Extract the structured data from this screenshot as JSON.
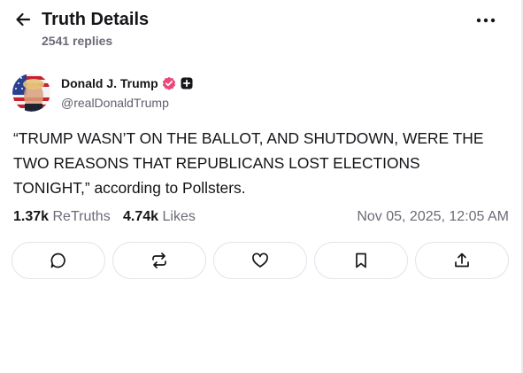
{
  "header": {
    "title": "Truth Details",
    "replies": "2541 replies",
    "back_icon": "arrow-left-icon",
    "more_icon": "ellipsis-icon"
  },
  "author": {
    "name": "Donald J. Trump",
    "handle": "@realDonaldTrump",
    "verified_icon": "verified-badge-icon",
    "verified_color": "#e8487a",
    "extra_badge_icon": "plus-badge-icon"
  },
  "post": {
    "text_lines": [
      "“TRUMP WASN’T ON THE BALLOT, AND SHUTDOWN, WERE THE",
      "TWO REASONS THAT REPUBLICANS LOST ELECTIONS",
      "TONIGHT,” according to Pollsters."
    ]
  },
  "stats": {
    "retruths_count": "1.37k",
    "retruths_label": "ReTruths",
    "likes_count": "4.74k",
    "likes_label": "Likes",
    "timestamp": "Nov 05, 2025, 12:05 AM"
  },
  "actions": [
    {
      "icon": "reply-icon"
    },
    {
      "icon": "retruth-icon"
    },
    {
      "icon": "like-icon"
    },
    {
      "icon": "bookmark-icon"
    },
    {
      "icon": "share-icon"
    }
  ],
  "colors": {
    "text_primary": "#16161a",
    "text_secondary": "#6b6b78",
    "button_border": "#e3e3ea"
  }
}
